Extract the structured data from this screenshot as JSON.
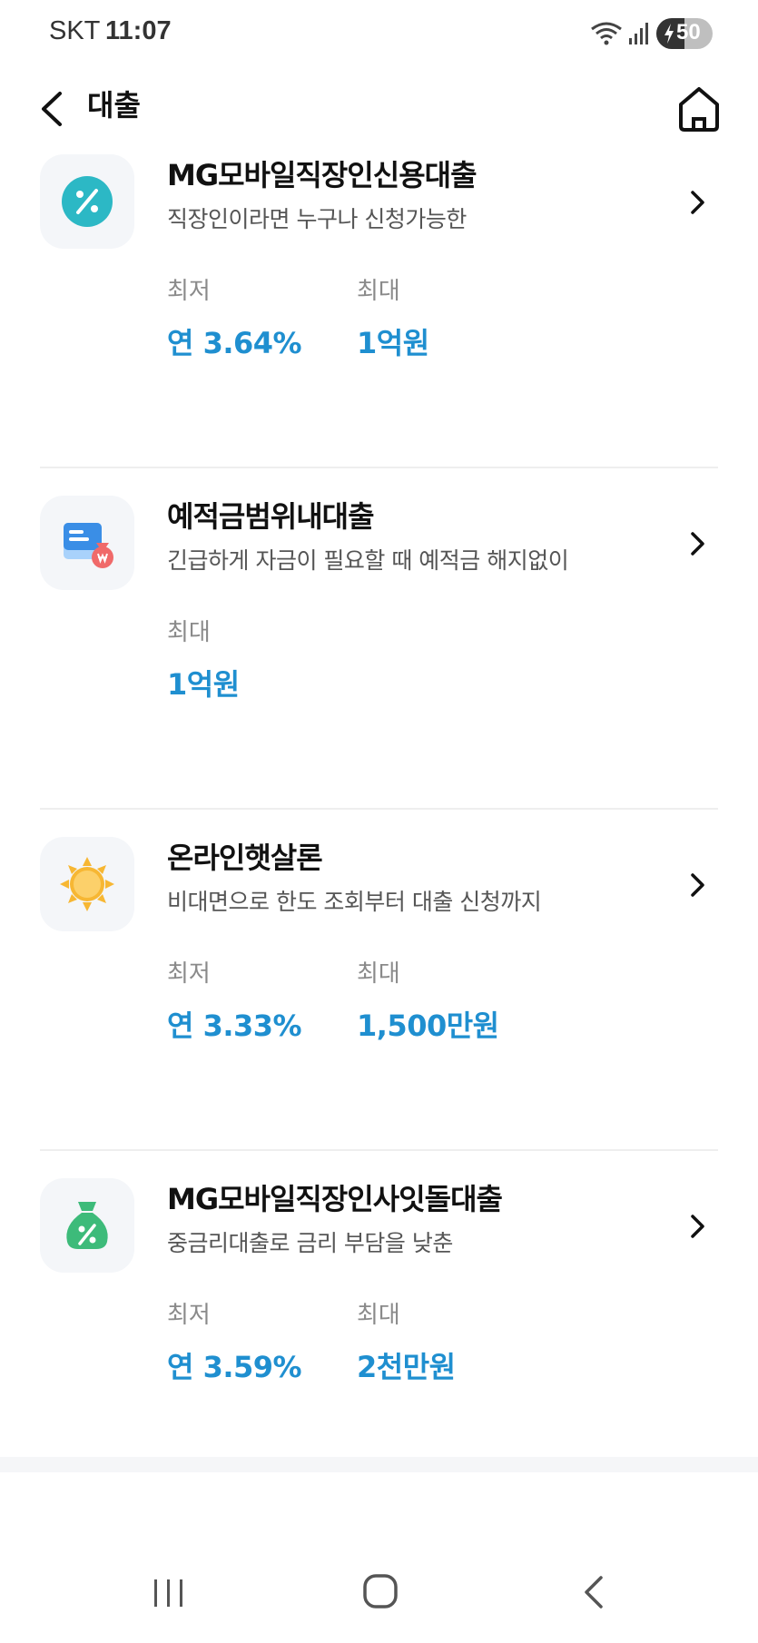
{
  "status_bar": {
    "carrier": "SKT",
    "time": "11:07",
    "battery": "50",
    "battery_level": 0.5
  },
  "header": {
    "title": "대출",
    "back_icon": "chevron-left-icon",
    "home_icon": "home-icon"
  },
  "loans": [
    {
      "name": "MG모바일직장인신용대출",
      "description": "직장인이라면 누구나 신청가능한",
      "icon": "percent-circle-icon",
      "icon_color": "#2cb8c5",
      "stats": [
        {
          "label": "최저",
          "value": "연 3.64%"
        },
        {
          "label": "최대",
          "value": "1억원"
        }
      ]
    },
    {
      "name": "예적금범위내대출",
      "description": "긴급하게 자금이 필요할 때 예적금 해지없이",
      "icon": "passbook-moneybag-icon",
      "icon_color": "#3a8ee6",
      "stats": [
        {
          "label": "최대",
          "value": "1억원"
        }
      ]
    },
    {
      "name": "온라인햇살론",
      "description": "비대면으로 한도 조회부터 대출 신청까지",
      "icon": "sun-icon",
      "icon_color": "#f7b733",
      "stats": [
        {
          "label": "최저",
          "value": "연 3.33%"
        },
        {
          "label": "최대",
          "value": "1,500만원"
        }
      ]
    },
    {
      "name": "MG모바일직장인사잇돌대출",
      "description": "중금리대출로 금리 부담을 낮춘",
      "icon": "percent-moneybag-icon",
      "icon_color": "#3dbb7a",
      "stats": [
        {
          "label": "최저",
          "value": "연 3.59%"
        },
        {
          "label": "최대",
          "value": "2천만원"
        }
      ]
    }
  ],
  "colors": {
    "accent": "#1f8fd0",
    "label": "#8a8a8a",
    "description": "#555555"
  },
  "nav_bar": {
    "recents_icon": "recents-icon",
    "home_icon": "home-circle-icon",
    "back_icon": "back-arrow-icon"
  }
}
